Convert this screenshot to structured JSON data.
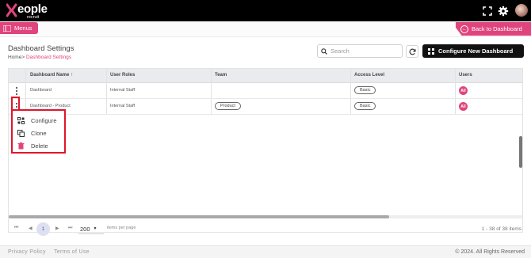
{
  "brand": {
    "logo_text": "eople",
    "logo_sub": "recruit",
    "accent_color": "#e0447c"
  },
  "topbar_icons": [
    "fullscreen-icon",
    "gear-icon",
    "avatar"
  ],
  "nav": {
    "menus_label": "Menus",
    "back_label": "Back to Dashboard"
  },
  "page": {
    "title": "Dashboard Settings",
    "breadcrumb": {
      "home": "Home",
      "separator": ">",
      "current": "Dashboard Settings"
    }
  },
  "toolbar": {
    "search_placeholder": "Search",
    "configure_label": "Configure New Dashboard"
  },
  "table": {
    "columns": [
      {
        "label": "Dashboard Name",
        "sort": "↑"
      },
      {
        "label": "User Roles"
      },
      {
        "label": "Team"
      },
      {
        "label": "Access Level"
      },
      {
        "label": "Users"
      }
    ],
    "rows": [
      {
        "name": "Dashboard",
        "roles": "Internal Staff",
        "team": "",
        "access": "Basic",
        "users": "All"
      },
      {
        "name": "Dashboard - Product",
        "roles": "Internal Staff",
        "team": "Product",
        "access": "Basic",
        "users": "All"
      }
    ]
  },
  "context_menu": {
    "items": [
      {
        "label": "Configure",
        "icon": "grid-icon"
      },
      {
        "label": "Clone",
        "icon": "copy-icon"
      },
      {
        "label": "Delete",
        "icon": "trash-icon",
        "color": "#e0447c"
      }
    ]
  },
  "pagination": {
    "first": "⏮",
    "prev": "◀",
    "current_page": "1",
    "next": "▶",
    "last": "⏭",
    "page_size": "200",
    "page_size_caption": "items per page",
    "count_text": "1 - 38 of 38 items"
  },
  "footer": {
    "privacy": "Privacy Policy",
    "terms": "Terms of Use",
    "copyright": "© 2024. All Rights Reserved"
  }
}
